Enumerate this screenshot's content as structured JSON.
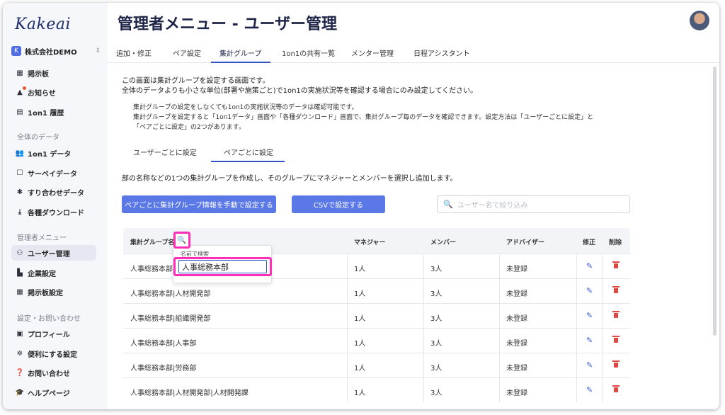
{
  "sidebar": {
    "logo": "Kakeai",
    "company": "株式会社DEMO",
    "company_icon": "K",
    "items_top": [
      {
        "label": "掲示板",
        "icon": "board-icon"
      },
      {
        "label": "お知らせ",
        "icon": "bell-icon"
      },
      {
        "label": "1on1 履歴",
        "icon": "history-icon"
      }
    ],
    "section_all": "全体のデータ",
    "items_all": [
      {
        "label": "1on1 データ",
        "icon": "people-icon"
      },
      {
        "label": "サーベイデータ",
        "icon": "calendar-icon"
      },
      {
        "label": "すり合わせデータ",
        "icon": "puzzle-icon"
      },
      {
        "label": "各種ダウンロード",
        "icon": "download-icon"
      }
    ],
    "section_admin": "管理者メニュー",
    "items_admin": [
      {
        "label": "ユーザー管理",
        "icon": "user-gear-icon"
      },
      {
        "label": "企業設定",
        "icon": "building-icon"
      },
      {
        "label": "掲示板設定",
        "icon": "board-settings-icon"
      }
    ],
    "section_settings": "設定・お問い合わせ",
    "items_settings": [
      {
        "label": "プロフィール",
        "icon": "profile-icon"
      },
      {
        "label": "便利にする設定",
        "icon": "gear-icon"
      },
      {
        "label": "お問い合わせ",
        "icon": "help-icon"
      },
      {
        "label": "ヘルプページ",
        "icon": "graduation-icon"
      }
    ]
  },
  "header": {
    "title": "管理者メニュー - ユーザー管理"
  },
  "tabs": [
    "追加・修正",
    "ペア設定",
    "集計グループ",
    "1on1の共有一覧",
    "メンター管理",
    "日程アシスタント"
  ],
  "description": {
    "line1": "この画面は集計グループを設定する画面です。",
    "line2": "全体のデータよりも小さな単位(部署や施策ごと)で1on1の実施状況等を確認する場合にのみ設定してください。",
    "note1": "集計グループの設定をしなくても1on1の実施状況等のデータは確認可能です。",
    "note2": "集計グループを設定すると「1on1データ」画面や「各種ダウンロード」画面で、集計グループ毎のデータを確認できます。設定方法は「ユーザーごとに設定」と",
    "note3": "「ペアごとに設定」の2つがあります。"
  },
  "subtabs": [
    "ユーザーごとに設定",
    "ペアごとに設定"
  ],
  "instruction": "部の名称などの1つの集計グループを作成し、そのグループにマネジャーとメンバーを選択し追加します。",
  "buttons": {
    "manual": "ペアごとに集計グループ情報を手動で設定する",
    "csv": "CSVで設定する"
  },
  "search": {
    "placeholder": "ユーザー名で絞り込み"
  },
  "table": {
    "headers": {
      "group": "集計グループ名",
      "manager": "マネジャー",
      "member": "メンバー",
      "advisor": "アドバイザー",
      "edit": "修正",
      "delete": "削除"
    },
    "rows": [
      {
        "group": "人事総務本部",
        "manager": "1人",
        "member": "3人",
        "advisor": "未登録"
      },
      {
        "group": "人事総務本部|人材開発部",
        "manager": "1人",
        "member": "3人",
        "advisor": "未登録"
      },
      {
        "group": "人事総務本部|組織開発部",
        "manager": "1人",
        "member": "3人",
        "advisor": "未登録"
      },
      {
        "group": "人事総務本部|人事部",
        "manager": "1人",
        "member": "3人",
        "advisor": "未登録"
      },
      {
        "group": "人事総務本部|労務部",
        "manager": "1人",
        "member": "3人",
        "advisor": "未登録"
      },
      {
        "group": "人事総務本部|人材開発部|人材開発課",
        "manager": "1人",
        "member": "3人",
        "advisor": "未登録"
      }
    ]
  },
  "filter_popover": {
    "label": "名前で検索",
    "value": "人事総務本部"
  },
  "colors": {
    "accent": "#3552c5",
    "button": "#5a78e6",
    "highlight": "#ff2fb7",
    "delete": "#e2473f"
  }
}
